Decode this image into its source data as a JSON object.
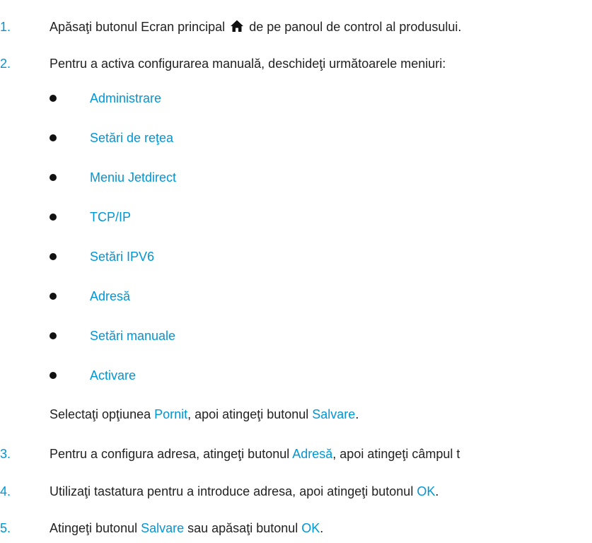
{
  "steps": [
    {
      "number": "1.",
      "text_before": "Apăsaţi butonul Ecran principal",
      "icon": "home-icon",
      "text_after": "de pe panoul de control al produsului."
    },
    {
      "number": "2.",
      "text": "Pentru a activa configurarea manuală, deschideţi următoarele meniuri:",
      "menus": [
        "Administrare",
        "Setări de reţea",
        "Meniu Jetdirect",
        "TCP/IP",
        "Setări IPV6",
        "Adresă",
        "Setări manuale",
        "Activare"
      ],
      "note": {
        "part1": "Selectaţi opţiunea ",
        "link1": "Pornit",
        "part2": ", apoi atingeţi butonul ",
        "link2": "Salvare",
        "part3": "."
      }
    },
    {
      "number": "3.",
      "part1": "Pentru a configura adresa, atingeţi butonul ",
      "link1": "Adresă",
      "part2": ", apoi atingeţi câmpul t"
    },
    {
      "number": "4.",
      "part1": "Utilizaţi tastatura pentru a introduce adresa, apoi atingeţi butonul ",
      "link1": "OK",
      "part2": "."
    },
    {
      "number": "5.",
      "part1": "Atingeţi butonul ",
      "link1": "Salvare",
      "part2": " sau apăsaţi butonul ",
      "link2": "OK",
      "part3": "."
    }
  ],
  "colors": {
    "accent": "#0096d6",
    "text": "#222222"
  }
}
